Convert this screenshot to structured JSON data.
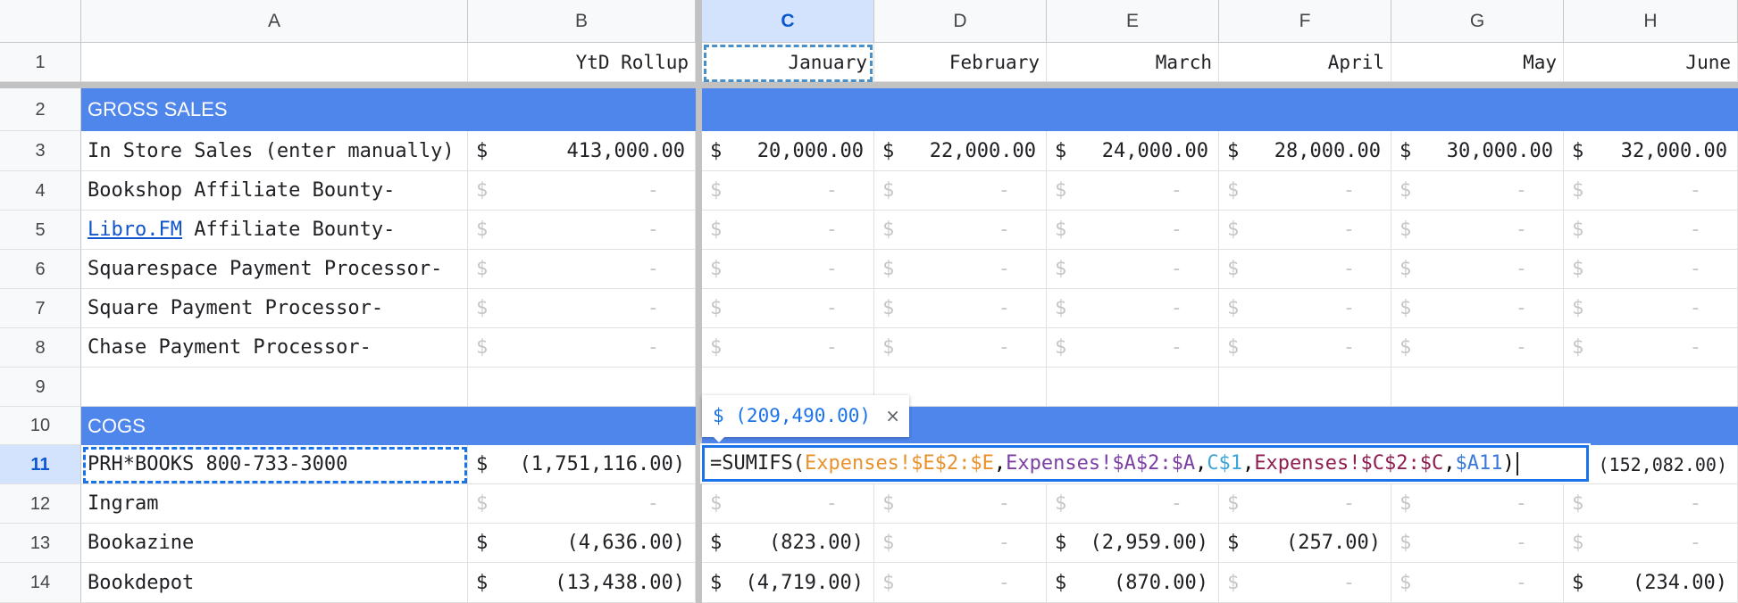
{
  "columns": [
    "A",
    "B",
    "C",
    "D",
    "E",
    "F",
    "G",
    "H"
  ],
  "rows": [
    "1",
    "2",
    "3",
    "4",
    "5",
    "6",
    "7",
    "8",
    "9",
    "10",
    "11",
    "12",
    "13",
    "14"
  ],
  "row1": [
    "",
    "YtD Rollup",
    "January",
    "February",
    "March",
    "April",
    "May",
    "June"
  ],
  "sections": {
    "gross_sales": "GROSS SALES",
    "cogs": "COGS"
  },
  "gross_rows": [
    {
      "label": "In Store Sales (enter manually)",
      "values": [
        "413,000.00",
        "20,000.00",
        "22,000.00",
        "24,000.00",
        "28,000.00",
        "30,000.00",
        "32,000.00"
      ]
    },
    {
      "label": "Bookshop Affiliate Bounty-"
    },
    {
      "label_link": "Libro.FM",
      "label_rest": " Affiliate Bounty-"
    },
    {
      "label": "Squarespace Payment Processor-"
    },
    {
      "label": "Square Payment Processor-"
    },
    {
      "label": "Chase Payment Processor-"
    }
  ],
  "cogs_rows": [
    {
      "label": "PRH*BOOKS 800-733-3000",
      "ytd": "(1,751,116.00)",
      "june": "(152,082.00)"
    },
    {
      "label": "Ingram"
    },
    {
      "label": "Bookazine",
      "values": [
        "(4,636.00)",
        "(823.00)",
        "-",
        "(2,959.00)",
        "(257.00)",
        "-",
        "-"
      ]
    },
    {
      "label": "Bookdepot",
      "values": [
        "(13,438.00)",
        "(4,719.00)",
        "-",
        "(870.00)",
        "-",
        "-",
        "(234.00)"
      ]
    }
  ],
  "symbols": {
    "dollar": "$",
    "dash": "-"
  },
  "formula_preview": {
    "value": "$ (209,490.00)",
    "close": "×"
  },
  "formula": {
    "eq": "=SUMIFS(",
    "arg1": "Expenses!$E$2:$E",
    "arg2": "Expenses!$A$2:$A",
    "arg3": "C$1",
    "arg4": "Expenses!$C$2:$C",
    "arg5": "$A11",
    "comma": ",",
    "close": ")"
  },
  "colors": {
    "band": "#4f86ec",
    "arg1": "#e8912d",
    "arg2": "#7b3fa4",
    "arg3": "#3ba5d8",
    "arg4": "#8f1d4f",
    "arg5": "#3a78d8"
  }
}
